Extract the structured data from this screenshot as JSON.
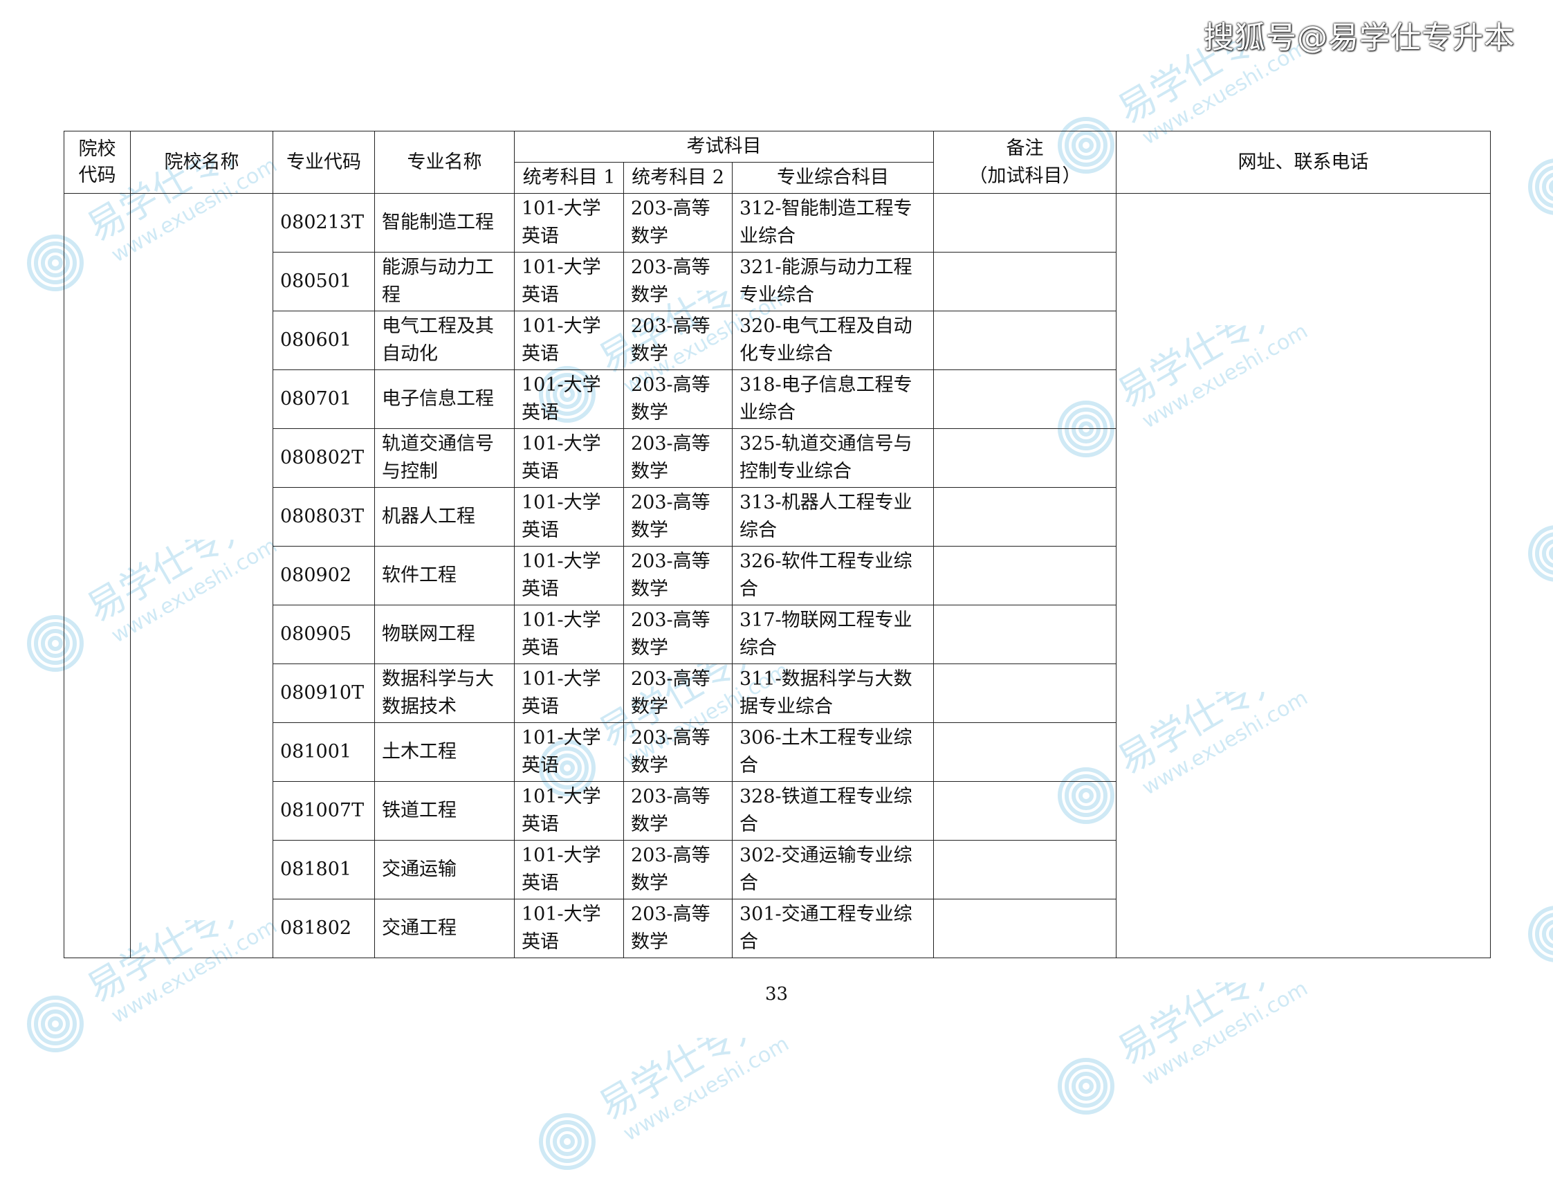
{
  "source_mark": "搜狐号@易学仕专升本",
  "watermark": {
    "text": "易学仕专升本",
    "url": "www.exueshi.com",
    "color": "#2a9fd6"
  },
  "table": {
    "headers": {
      "school_code": "院校\n代码",
      "school_name": "院校名称",
      "major_code": "专业代码",
      "major_name": "专业名称",
      "exam_subjects": "考试科目",
      "subject1": "统考科目 1",
      "subject2": "统考科目 2",
      "subject3": "专业综合科目",
      "remarks": "备注\n（加试科目）",
      "contact": "网址、联系电话"
    },
    "rows": [
      {
        "code": "080213T",
        "name": "智能制造工程",
        "s1": "101-大学英语",
        "s2": "203-高等数学",
        "s3": "312-智能制造工程专业综合",
        "remark": ""
      },
      {
        "code": "080501",
        "name": "能源与动力工程",
        "s1": "101-大学英语",
        "s2": "203-高等数学",
        "s3": "321-能源与动力工程专业综合",
        "remark": ""
      },
      {
        "code": "080601",
        "name": "电气工程及其自动化",
        "s1": "101-大学英语",
        "s2": "203-高等数学",
        "s3": "320-电气工程及自动化专业综合",
        "remark": ""
      },
      {
        "code": "080701",
        "name": "电子信息工程",
        "s1": "101-大学英语",
        "s2": "203-高等数学",
        "s3": "318-电子信息工程专业综合",
        "remark": ""
      },
      {
        "code": "080802T",
        "name": "轨道交通信号与控制",
        "s1": "101-大学英语",
        "s2": "203-高等数学",
        "s3": "325-轨道交通信号与控制专业综合",
        "remark": ""
      },
      {
        "code": "080803T",
        "name": "机器人工程",
        "s1": "101-大学英语",
        "s2": "203-高等数学",
        "s3": "313-机器人工程专业综合",
        "remark": ""
      },
      {
        "code": "080902",
        "name": "软件工程",
        "s1": "101-大学英语",
        "s2": "203-高等数学",
        "s3": "326-软件工程专业综合",
        "remark": ""
      },
      {
        "code": "080905",
        "name": "物联网工程",
        "s1": "101-大学英语",
        "s2": "203-高等数学",
        "s3": "317-物联网工程专业综合",
        "remark": ""
      },
      {
        "code": "080910T",
        "name": "数据科学与大数据技术",
        "s1": "101-大学英语",
        "s2": "203-高等数学",
        "s3": "311-数据科学与大数据专业综合",
        "remark": ""
      },
      {
        "code": "081001",
        "name": "土木工程",
        "s1": "101-大学英语",
        "s2": "203-高等数学",
        "s3": "306-土木工程专业综合",
        "remark": ""
      },
      {
        "code": "081007T",
        "name": "铁道工程",
        "s1": "101-大学英语",
        "s2": "203-高等数学",
        "s3": "328-铁道工程专业综合",
        "remark": ""
      },
      {
        "code": "081801",
        "name": "交通运输",
        "s1": "101-大学英语",
        "s2": "203-高等数学",
        "s3": "302-交通运输专业综合",
        "remark": ""
      },
      {
        "code": "081802",
        "name": "交通工程",
        "s1": "101-大学英语",
        "s2": "203-高等数学",
        "s3": "301-交通工程专业综合",
        "remark": ""
      }
    ]
  },
  "page_number": "33"
}
